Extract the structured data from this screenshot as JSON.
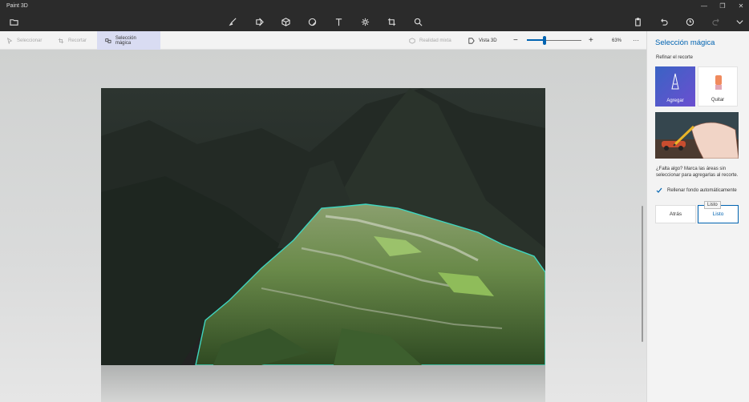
{
  "app": {
    "title": "Paint 3D"
  },
  "toolbar": {
    "select_label": "Seleccionar",
    "crop_label": "Recortar",
    "magic_select_label": "Selección mágica",
    "mixed_reality_label": "Realidad mixta",
    "view3d_label": "Vista 3D",
    "zoom_level": "63%",
    "zoom_fraction": 0.33,
    "zoom_minus": "−",
    "zoom_plus": "+",
    "more": "···"
  },
  "panel": {
    "title": "Selección mágica",
    "subtitle": "Refinar el recorte",
    "add_label": "Agregar",
    "remove_label": "Quitar",
    "hint": "¿Falta algo? Marca las áreas sin seleccionar para agregarlas al recorte.",
    "auto_fill_label": "Rellenar fondo automáticamente",
    "auto_fill_checked": true,
    "back_label": "Atrás",
    "done_label": "Listo",
    "tooltip": "Listo"
  },
  "colors": {
    "accent": "#0063b1",
    "selection_outline": "#3fd6c0",
    "add_gradient_start": "#3a63c4",
    "add_gradient_end": "#6b4fd0"
  },
  "icons": [
    "folder-icon",
    "brush-icon",
    "2d-shapes-icon",
    "3d-shapes-icon",
    "stickers-icon",
    "text-icon",
    "effects-icon",
    "canvas-icon",
    "3d-library-icon",
    "paste-icon",
    "undo-icon",
    "history-icon",
    "redo-icon",
    "expand-icon"
  ]
}
